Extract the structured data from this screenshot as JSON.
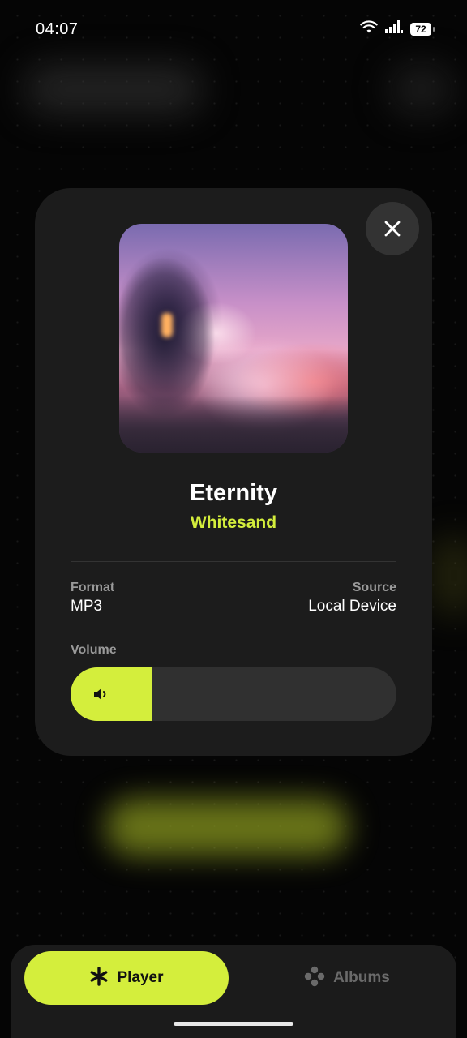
{
  "status_bar": {
    "time": "04:07",
    "battery_level": "72",
    "wifi_icon": "wifi-icon",
    "signal_icon": "signal-bars-icon"
  },
  "now_playing": {
    "title": "Eternity",
    "artist": "Whitesand",
    "close_icon": "close-icon",
    "artwork": "album-artwork"
  },
  "details": {
    "format_label": "Format",
    "format_value": "MP3",
    "source_label": "Source",
    "source_value": "Local Device"
  },
  "volume": {
    "label": "Volume",
    "level": 0.25,
    "icon": "speaker-icon"
  },
  "nav": {
    "tabs": [
      {
        "label": "Player",
        "icon": "asterisk-icon",
        "active": true
      },
      {
        "label": "Albums",
        "icon": "albums-icon",
        "active": false
      }
    ]
  },
  "colors": {
    "accent": "#d4ee3c",
    "card": "#1c1c1c",
    "background": "#050505"
  }
}
